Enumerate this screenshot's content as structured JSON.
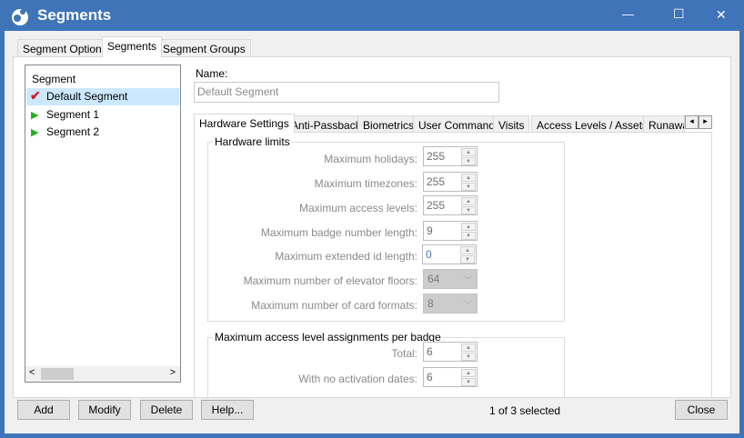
{
  "window": {
    "title": "Segments",
    "minimize": "—",
    "maximize": "☐",
    "close": "✕"
  },
  "top_tabs": [
    "Segment Options",
    "Segments",
    "Segment Groups"
  ],
  "segment_list": {
    "header": "Segment",
    "items": [
      {
        "label": "Default Segment",
        "icon": "default-check-icon",
        "selected": true
      },
      {
        "label": "Segment 1",
        "icon": "green-flag-icon"
      },
      {
        "label": "Segment 2",
        "icon": "green-flag-icon"
      }
    ],
    "scroll_left": "<",
    "scroll_right": ">"
  },
  "name": {
    "label": "Name:",
    "value": "Default Segment"
  },
  "inner_tabs": [
    "Hardware Settings",
    "Anti-Passback",
    "Biometrics",
    "User Commands",
    "Visits",
    "Access Levels / Assets",
    "Runawa"
  ],
  "tab_scroll": {
    "left": "◂",
    "right": "▸"
  },
  "hardware_limits": {
    "title": "Hardware limits",
    "rows": [
      {
        "label": "Maximum holidays:",
        "value": "255",
        "type": "spin"
      },
      {
        "label": "Maximum timezones:",
        "value": "255",
        "type": "spin"
      },
      {
        "label": "Maximum access levels:",
        "value": "255",
        "type": "spin"
      },
      {
        "label": "Maximum badge number length:",
        "value": "9",
        "type": "spin"
      },
      {
        "label": "Maximum extended id length:",
        "value": "0",
        "type": "spin"
      },
      {
        "label": "Maximum number of elevator floors:",
        "value": "64",
        "type": "combo"
      },
      {
        "label": "Maximum number of card formats:",
        "value": "8",
        "type": "combo"
      }
    ]
  },
  "assignments": {
    "title": "Maximum access level assignments per badge",
    "rows": [
      {
        "label": "Total:",
        "value": "6"
      },
      {
        "label": "With no activation dates:",
        "value": "6"
      }
    ]
  },
  "buttons": {
    "add": "Add",
    "modify": "Modify",
    "delete": "Delete",
    "help": "Help...",
    "close": "Close"
  },
  "status": "1 of 3 selected"
}
